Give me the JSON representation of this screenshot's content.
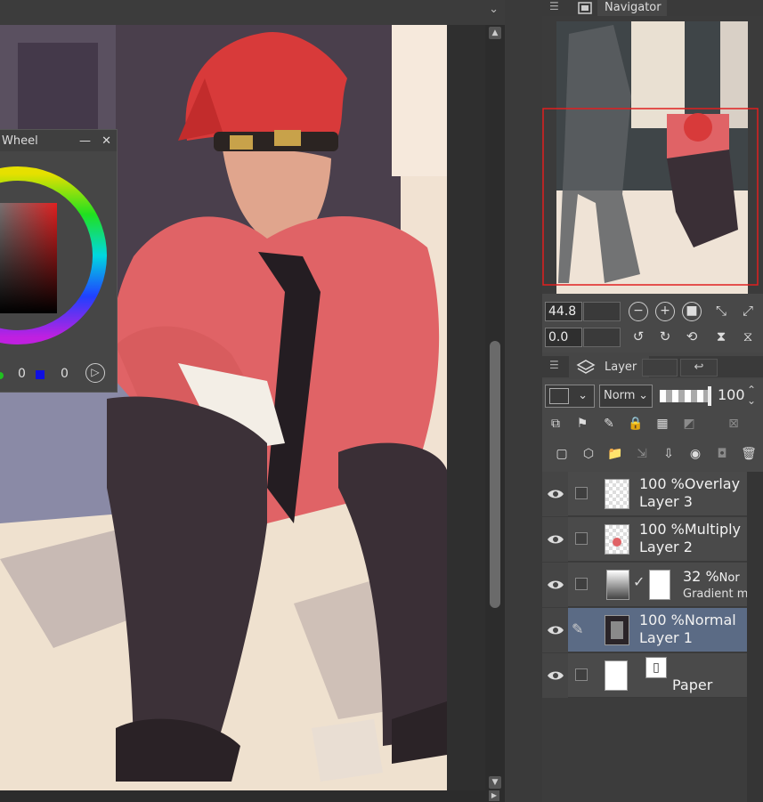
{
  "navigator": {
    "title": "Navigator"
  },
  "color_wheel": {
    "title": "Wheel",
    "g_value": "0",
    "b_value": "0"
  },
  "nav_controls": {
    "zoom": "44.8",
    "rotation": "0.0"
  },
  "layer_panel": {
    "title": "Layer",
    "blend_mode": "Norm",
    "opacity": "100",
    "layers": [
      {
        "opacity": "100 %",
        "mode": "Overlay",
        "name": "Layer 3"
      },
      {
        "opacity": "100 %",
        "mode": "Multiply",
        "name": "Layer 2"
      },
      {
        "opacity": "32 %",
        "mode": "Nor",
        "name": "Gradient m"
      },
      {
        "opacity": "100 %",
        "mode": "Normal",
        "name": "Layer 1"
      },
      {
        "name": "Paper"
      }
    ]
  },
  "colors": {
    "panel": "#464646",
    "selected_layer": "#5b6b85",
    "nav_frame": "#e02020"
  }
}
